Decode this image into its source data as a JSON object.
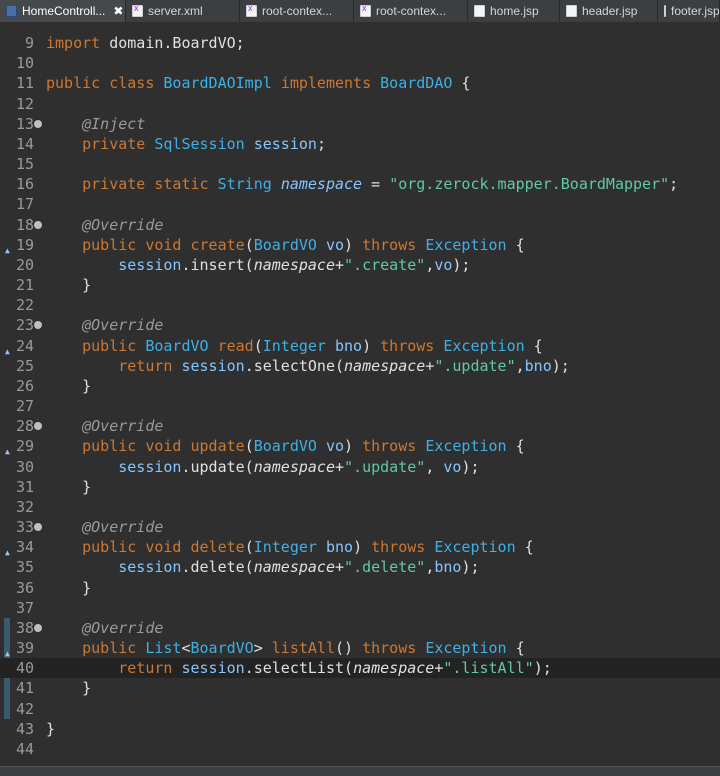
{
  "tabs": [
    {
      "label": "HomeControll...",
      "icon": "java-file-icon",
      "active": true,
      "close": "✖"
    },
    {
      "label": "server.xml",
      "icon": "xml-file-icon"
    },
    {
      "label": "root-contex...",
      "icon": "xml-file-icon"
    },
    {
      "label": "root-contex...",
      "icon": "xml-file-icon"
    },
    {
      "label": "home.jsp",
      "icon": "jsp-file-icon"
    },
    {
      "label": "header.jsp",
      "icon": "jsp-file-icon"
    },
    {
      "label": "footer.jsp",
      "icon": "jsp-file-icon"
    }
  ],
  "editor": {
    "lines": [
      {
        "n": "9",
        "tokens": [
          [
            "kw",
            "import"
          ],
          [
            "plain",
            " domain.BoardVO;"
          ]
        ]
      },
      {
        "n": "10",
        "tokens": []
      },
      {
        "n": "11",
        "tokens": [
          [
            "kw",
            "public"
          ],
          [
            "plain",
            " "
          ],
          [
            "kw",
            "class"
          ],
          [
            "plain",
            " "
          ],
          [
            "cls",
            "BoardDAOImpl"
          ],
          [
            "plain",
            " "
          ],
          [
            "kw",
            "implements"
          ],
          [
            "plain",
            " "
          ],
          [
            "cls",
            "BoardDAO"
          ],
          [
            "plain",
            " {"
          ]
        ]
      },
      {
        "n": "12",
        "tokens": []
      },
      {
        "n": "13",
        "fold": true,
        "tokens": [
          [
            "plain",
            "    "
          ],
          [
            "ann",
            "@Inject"
          ]
        ]
      },
      {
        "n": "14",
        "tokens": [
          [
            "plain",
            "    "
          ],
          [
            "kw",
            "private"
          ],
          [
            "plain",
            " "
          ],
          [
            "cls",
            "SqlSession"
          ],
          [
            "plain",
            " "
          ],
          [
            "fld",
            "session"
          ],
          [
            "plain",
            ";"
          ]
        ]
      },
      {
        "n": "15",
        "tokens": []
      },
      {
        "n": "16",
        "tokens": [
          [
            "plain",
            "    "
          ],
          [
            "kw",
            "private"
          ],
          [
            "plain",
            " "
          ],
          [
            "kw",
            "static"
          ],
          [
            "plain",
            " "
          ],
          [
            "cls",
            "String"
          ],
          [
            "plain",
            " "
          ],
          [
            "fld ital",
            "namespace"
          ],
          [
            "plain",
            " = "
          ],
          [
            "str",
            "\"org.zerock.mapper.BoardMapper\""
          ],
          [
            "plain",
            ";"
          ]
        ]
      },
      {
        "n": "17",
        "tokens": []
      },
      {
        "n": "18",
        "fold": true,
        "tokens": [
          [
            "plain",
            "    "
          ],
          [
            "ann",
            "@Override"
          ]
        ]
      },
      {
        "n": "19",
        "override": true,
        "tokens": [
          [
            "plain",
            "    "
          ],
          [
            "kw",
            "public"
          ],
          [
            "plain",
            " "
          ],
          [
            "kw",
            "void"
          ],
          [
            "plain",
            " "
          ],
          [
            "kw",
            "create"
          ],
          [
            "plain",
            "("
          ],
          [
            "cls",
            "BoardVO"
          ],
          [
            "plain",
            " "
          ],
          [
            "fld",
            "vo"
          ],
          [
            "plain",
            ") "
          ],
          [
            "kw",
            "throws"
          ],
          [
            "plain",
            " "
          ],
          [
            "cls",
            "Exception"
          ],
          [
            "plain",
            " {"
          ]
        ]
      },
      {
        "n": "20",
        "tokens": [
          [
            "plain",
            "        "
          ],
          [
            "fld",
            "session"
          ],
          [
            "plain",
            ".insert("
          ],
          [
            "plain ital",
            "namespace"
          ],
          [
            "plain",
            "+"
          ],
          [
            "str",
            "\".create\""
          ],
          [
            "plain",
            ","
          ],
          [
            "fld",
            "vo"
          ],
          [
            "plain",
            ");"
          ]
        ]
      },
      {
        "n": "21",
        "tokens": [
          [
            "plain",
            "    }"
          ]
        ]
      },
      {
        "n": "22",
        "tokens": []
      },
      {
        "n": "23",
        "fold": true,
        "tokens": [
          [
            "plain",
            "    "
          ],
          [
            "ann",
            "@Override"
          ]
        ]
      },
      {
        "n": "24",
        "override": true,
        "tokens": [
          [
            "plain",
            "    "
          ],
          [
            "kw",
            "public"
          ],
          [
            "plain",
            " "
          ],
          [
            "cls",
            "BoardVO"
          ],
          [
            "plain",
            " "
          ],
          [
            "kw",
            "read"
          ],
          [
            "plain",
            "("
          ],
          [
            "cls",
            "Integer"
          ],
          [
            "plain",
            " "
          ],
          [
            "fld",
            "bno"
          ],
          [
            "plain",
            ") "
          ],
          [
            "kw",
            "throws"
          ],
          [
            "plain",
            " "
          ],
          [
            "cls",
            "Exception"
          ],
          [
            "plain",
            " {"
          ]
        ]
      },
      {
        "n": "25",
        "tokens": [
          [
            "plain",
            "        "
          ],
          [
            "kw",
            "return"
          ],
          [
            "plain",
            " "
          ],
          [
            "fld",
            "session"
          ],
          [
            "plain",
            ".selectOne("
          ],
          [
            "plain ital",
            "namespace"
          ],
          [
            "plain",
            "+"
          ],
          [
            "str",
            "\".update\""
          ],
          [
            "plain",
            ","
          ],
          [
            "fld",
            "bno"
          ],
          [
            "plain",
            ");"
          ]
        ]
      },
      {
        "n": "26",
        "tokens": [
          [
            "plain",
            "    }"
          ]
        ]
      },
      {
        "n": "27",
        "tokens": []
      },
      {
        "n": "28",
        "fold": true,
        "tokens": [
          [
            "plain",
            "    "
          ],
          [
            "ann",
            "@Override"
          ]
        ]
      },
      {
        "n": "29",
        "override": true,
        "tokens": [
          [
            "plain",
            "    "
          ],
          [
            "kw",
            "public"
          ],
          [
            "plain",
            " "
          ],
          [
            "kw",
            "void"
          ],
          [
            "plain",
            " "
          ],
          [
            "kw",
            "update"
          ],
          [
            "plain",
            "("
          ],
          [
            "cls",
            "BoardVO"
          ],
          [
            "plain",
            " "
          ],
          [
            "fld",
            "vo"
          ],
          [
            "plain",
            ") "
          ],
          [
            "kw",
            "throws"
          ],
          [
            "plain",
            " "
          ],
          [
            "cls",
            "Exception"
          ],
          [
            "plain",
            " {"
          ]
        ]
      },
      {
        "n": "30",
        "tokens": [
          [
            "plain",
            "        "
          ],
          [
            "fld",
            "session"
          ],
          [
            "plain",
            ".update("
          ],
          [
            "plain ital",
            "namespace"
          ],
          [
            "plain",
            "+"
          ],
          [
            "str",
            "\".update\""
          ],
          [
            "plain",
            ", "
          ],
          [
            "fld",
            "vo"
          ],
          [
            "plain",
            ");"
          ]
        ]
      },
      {
        "n": "31",
        "tokens": [
          [
            "plain",
            "    }"
          ]
        ]
      },
      {
        "n": "32",
        "tokens": []
      },
      {
        "n": "33",
        "fold": true,
        "tokens": [
          [
            "plain",
            "    "
          ],
          [
            "ann",
            "@Override"
          ]
        ]
      },
      {
        "n": "34",
        "override": true,
        "tokens": [
          [
            "plain",
            "    "
          ],
          [
            "kw",
            "public"
          ],
          [
            "plain",
            " "
          ],
          [
            "kw",
            "void"
          ],
          [
            "plain",
            " "
          ],
          [
            "kw",
            "delete"
          ],
          [
            "plain",
            "("
          ],
          [
            "cls",
            "Integer"
          ],
          [
            "plain",
            " "
          ],
          [
            "fld",
            "bno"
          ],
          [
            "plain",
            ") "
          ],
          [
            "kw",
            "throws"
          ],
          [
            "plain",
            " "
          ],
          [
            "cls",
            "Exception"
          ],
          [
            "plain",
            " {"
          ]
        ]
      },
      {
        "n": "35",
        "tokens": [
          [
            "plain",
            "        "
          ],
          [
            "fld",
            "session"
          ],
          [
            "plain",
            ".delete("
          ],
          [
            "plain ital",
            "namespace"
          ],
          [
            "plain",
            "+"
          ],
          [
            "str",
            "\".delete\""
          ],
          [
            "plain",
            ","
          ],
          [
            "fld",
            "bno"
          ],
          [
            "plain",
            ");"
          ]
        ]
      },
      {
        "n": "36",
        "tokens": [
          [
            "plain",
            "    }"
          ]
        ]
      },
      {
        "n": "37",
        "tokens": []
      },
      {
        "n": "38",
        "fold": true,
        "tokens": [
          [
            "plain",
            "    "
          ],
          [
            "ann",
            "@Override"
          ]
        ]
      },
      {
        "n": "39",
        "override": true,
        "tokens": [
          [
            "plain",
            "    "
          ],
          [
            "kw",
            "public"
          ],
          [
            "plain",
            " "
          ],
          [
            "cls",
            "List"
          ],
          [
            "plain",
            "<"
          ],
          [
            "cls",
            "BoardVO"
          ],
          [
            "plain",
            "> "
          ],
          [
            "kw",
            "listAll"
          ],
          [
            "plain",
            "() "
          ],
          [
            "kw",
            "throws"
          ],
          [
            "plain",
            " "
          ],
          [
            "cls",
            "Exception"
          ],
          [
            "plain",
            " {"
          ]
        ]
      },
      {
        "n": "40",
        "current": true,
        "tokens": [
          [
            "plain",
            "        "
          ],
          [
            "kw",
            "return"
          ],
          [
            "plain",
            " "
          ],
          [
            "fld",
            "session"
          ],
          [
            "plain",
            ".selectList("
          ],
          [
            "plain ital",
            "namespace"
          ],
          [
            "plain",
            "+"
          ],
          [
            "str",
            "\".listAll\""
          ],
          [
            "plain",
            ");"
          ]
        ]
      },
      {
        "n": "41",
        "tokens": [
          [
            "plain",
            "    }"
          ]
        ]
      },
      {
        "n": "42",
        "tokens": []
      },
      {
        "n": "43",
        "tokens": [
          [
            "plain",
            "}"
          ]
        ]
      },
      {
        "n": "44",
        "tokens": []
      }
    ]
  }
}
